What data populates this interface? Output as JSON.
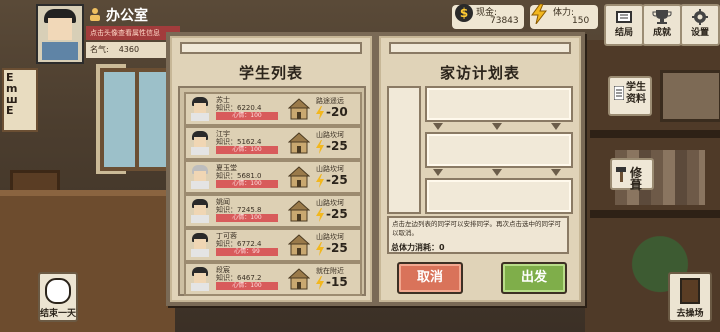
{
  "header": {
    "location": "办公室",
    "hint": "点击头像查看属性信息",
    "fame_label": "名气:",
    "fame_value": "4360"
  },
  "resources": {
    "cash_label": "现金:",
    "cash_value": "73843",
    "energy_label": "体力:",
    "energy_value": "150"
  },
  "top_buttons": [
    {
      "label": "结局",
      "icon": "ending-icon"
    },
    {
      "label": "成就",
      "icon": "trophy-icon"
    },
    {
      "label": "设置",
      "icon": "gear-icon"
    }
  ],
  "side_buttons": {
    "profile": "学生资料",
    "repair": "修葺"
  },
  "bottom": {
    "end_day": "结束一天",
    "playground": "去操场"
  },
  "eye_chart": "E\nm\nш\nE",
  "student_list": {
    "title": "学生列表",
    "rows": [
      {
        "name": "苏士",
        "knowledge": "知识：6220.4",
        "mood": "心情：100",
        "location": "路途遥远",
        "cost": "-20"
      },
      {
        "name": "江宇",
        "knowledge": "知识：5162.4",
        "mood": "心情：100",
        "location": "山路坎坷",
        "cost": "-25"
      },
      {
        "name": "夏玉堂",
        "knowledge": "知识：5681.0",
        "mood": "心情：100",
        "location": "山路坎坷",
        "cost": "-25"
      },
      {
        "name": "姚闻",
        "knowledge": "知识：7245.8",
        "mood": "心情：100",
        "location": "山路坎坷",
        "cost": "-25"
      },
      {
        "name": "丁可蓉",
        "knowledge": "知识：6772.4",
        "mood": "心情：99",
        "location": "山路坎坷",
        "cost": "-25"
      },
      {
        "name": "段宸",
        "knowledge": "知识：6467.2",
        "mood": "心情：100",
        "location": "就在附近",
        "cost": "-15"
      }
    ]
  },
  "plan": {
    "title": "家访计划表",
    "note": "点击左边列表的同学可以安排同学。再次点击选中的同学可以取消。",
    "total_label": "总体力消耗：",
    "total_value": "0",
    "cancel": "取消",
    "go": "出发"
  }
}
